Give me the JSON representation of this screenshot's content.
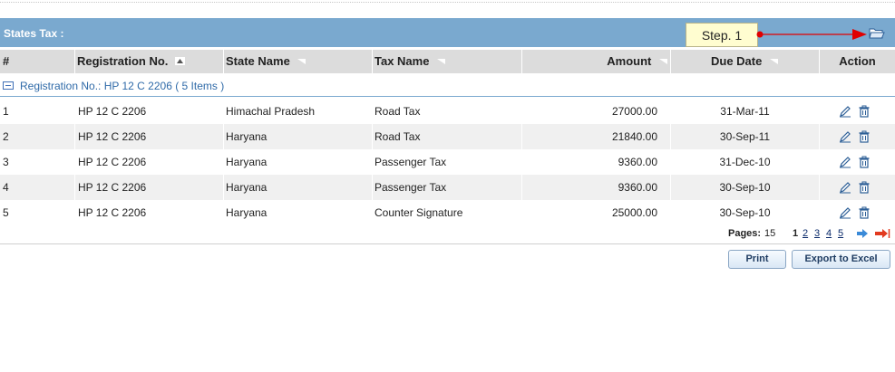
{
  "panel": {
    "title": "States Tax :"
  },
  "callout": {
    "text": "Step. 1"
  },
  "icons": {
    "folder": "folder-open-icon",
    "edit": "pencil-edit-icon",
    "delete": "trash-icon",
    "next": "next-arrow-icon",
    "last": "last-arrow-icon",
    "collapse": "collapse-group-icon"
  },
  "colors": {
    "header_bar": "#7aa9cf",
    "column_header": "#dcdcdc",
    "group_text": "#2f6aa8",
    "alt_row": "#f0f0f0",
    "arrow": "#e00000"
  },
  "columns": {
    "num": "#",
    "reg": "Registration No.",
    "state": "State Name",
    "tax": "Tax Name",
    "amount": "Amount",
    "due": "Due Date",
    "action": "Action"
  },
  "group": {
    "label": "Registration No.: HP 12 C 2206 ( 5 Items )"
  },
  "rows": [
    {
      "num": "1",
      "reg": "HP 12 C 2206",
      "state": "Himachal Pradesh",
      "tax": "Road Tax",
      "amount": "27000.00",
      "due": "31-Mar-11"
    },
    {
      "num": "2",
      "reg": "HP 12 C 2206",
      "state": "Haryana",
      "tax": "Road Tax",
      "amount": "21840.00",
      "due": "30-Sep-11"
    },
    {
      "num": "3",
      "reg": "HP 12 C 2206",
      "state": "Haryana",
      "tax": "Passenger Tax",
      "amount": "9360.00",
      "due": "31-Dec-10"
    },
    {
      "num": "4",
      "reg": "HP 12 C 2206",
      "state": "Haryana",
      "tax": "Passenger Tax",
      "amount": "9360.00",
      "due": "30-Sep-10"
    },
    {
      "num": "5",
      "reg": "HP 12 C 2206",
      "state": "Haryana",
      "tax": "Counter Signature",
      "amount": "25000.00",
      "due": "30-Sep-10"
    }
  ],
  "pager": {
    "label": "Pages:",
    "count": "15",
    "pages": [
      "1",
      "2",
      "3",
      "4",
      "5"
    ],
    "current": "1"
  },
  "buttons": {
    "print": "Print",
    "export": "Export to Excel"
  }
}
